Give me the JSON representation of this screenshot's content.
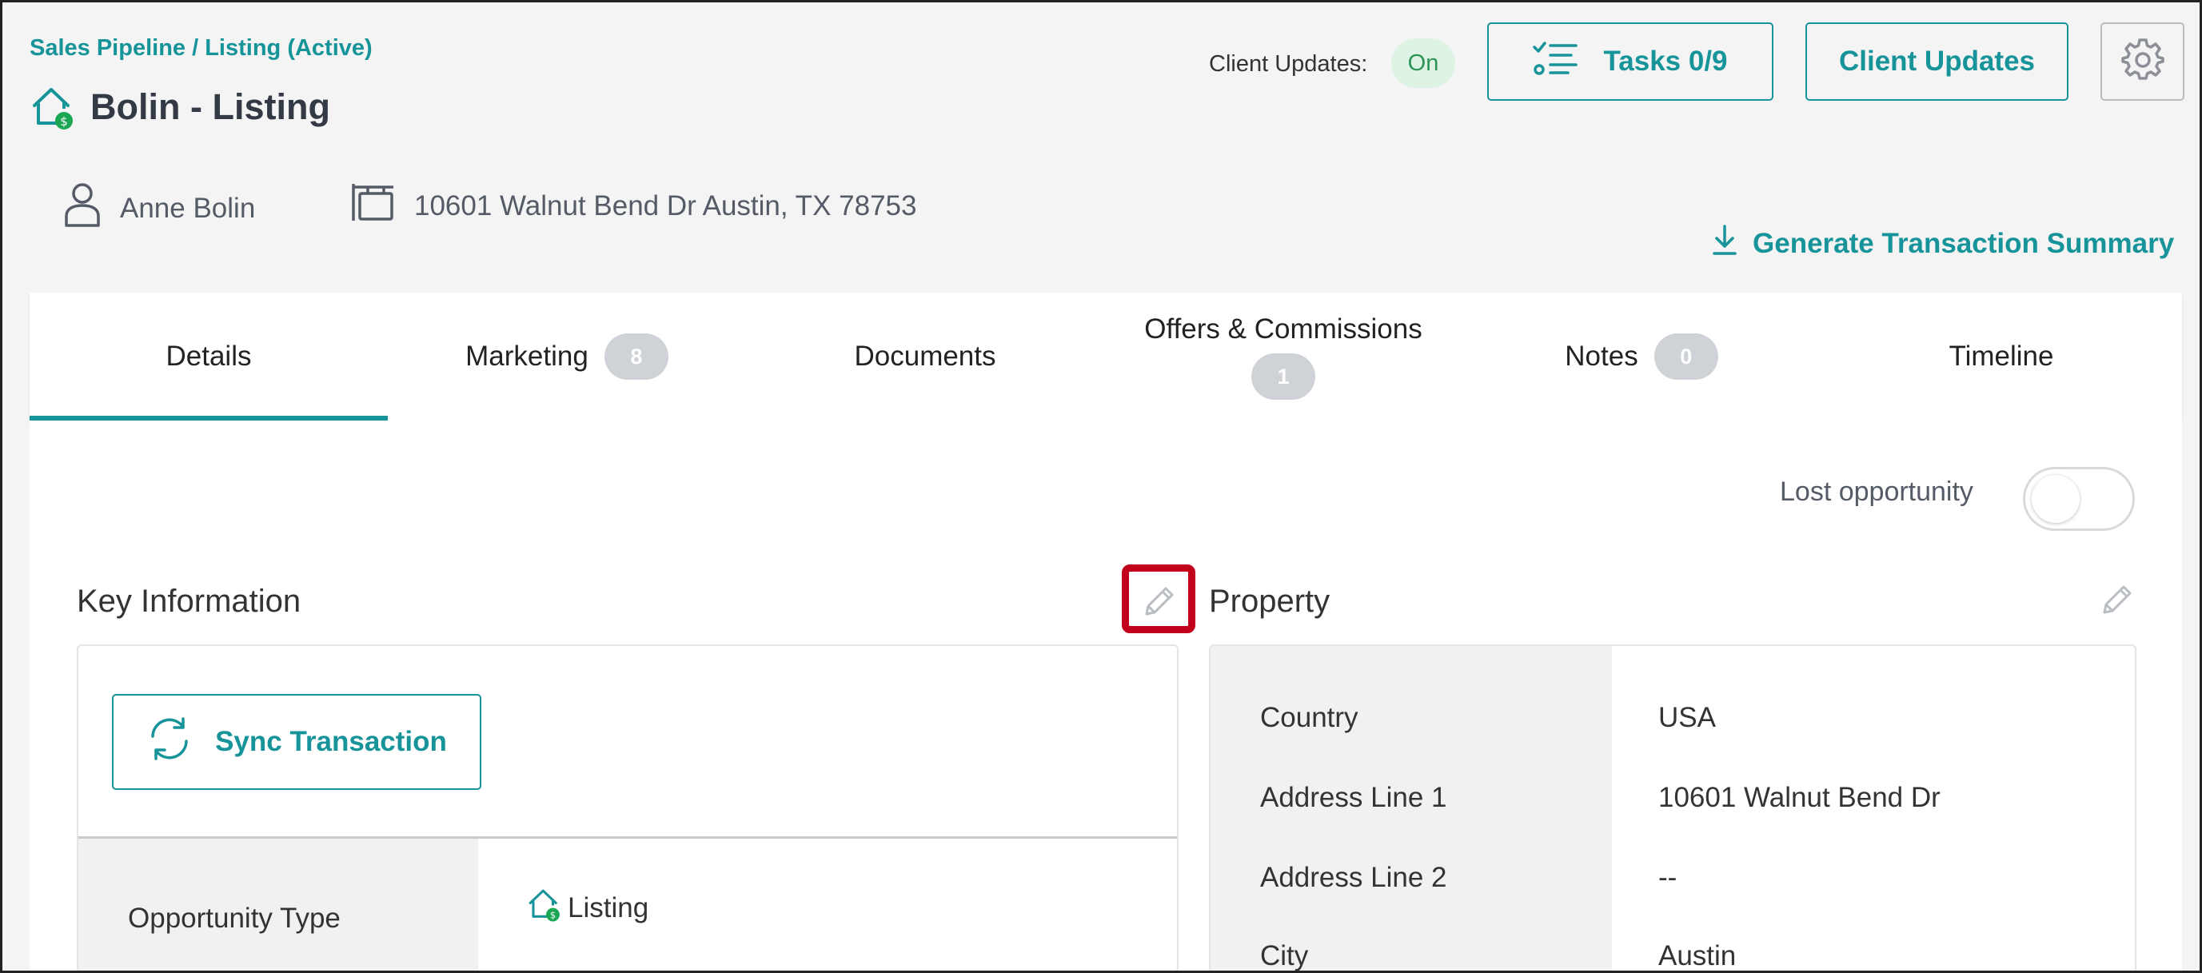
{
  "breadcrumb": {
    "root": "Sales Pipeline",
    "separator": " / ",
    "current": "Listing (Active)"
  },
  "title": "Bolin - Listing",
  "header": {
    "client_updates_label": "Client Updates:",
    "client_updates_status": "On",
    "tasks_label": "Tasks 0/9",
    "client_updates_button": "Client Updates"
  },
  "contact": {
    "name": "Anne Bolin",
    "address": "10601 Walnut Bend Dr Austin, TX 78753"
  },
  "generate_summary": "Generate Transaction Summary",
  "tabs": [
    {
      "label": "Details",
      "active": true
    },
    {
      "label": "Marketing",
      "badge": "8"
    },
    {
      "label": "Documents"
    },
    {
      "label": "Offers & Commissions",
      "badge": "1"
    },
    {
      "label": "Notes",
      "badge": "0"
    },
    {
      "label": "Timeline"
    }
  ],
  "lost_opportunity": {
    "label": "Lost opportunity",
    "enabled": false
  },
  "key_information": {
    "title": "Key Information",
    "sync_button": "Sync Transaction",
    "rows": [
      {
        "label": "Opportunity Type",
        "value": "Listing"
      }
    ]
  },
  "property": {
    "title": "Property",
    "rows": [
      {
        "label": "Country",
        "value": "USA"
      },
      {
        "label": "Address Line 1",
        "value": "10601 Walnut Bend Dr"
      },
      {
        "label": "Address Line 2",
        "value": "--"
      },
      {
        "label": "City",
        "value": "Austin"
      }
    ]
  },
  "colors": {
    "accent": "#17949a",
    "highlight": "#c3001c",
    "on_badge_bg": "#dff3e4"
  },
  "icons": [
    "house-dollar-icon",
    "tasks-checklist-icon",
    "gear-icon",
    "person-icon",
    "sign-icon",
    "download-icon",
    "sync-icon",
    "pencil-icon"
  ]
}
